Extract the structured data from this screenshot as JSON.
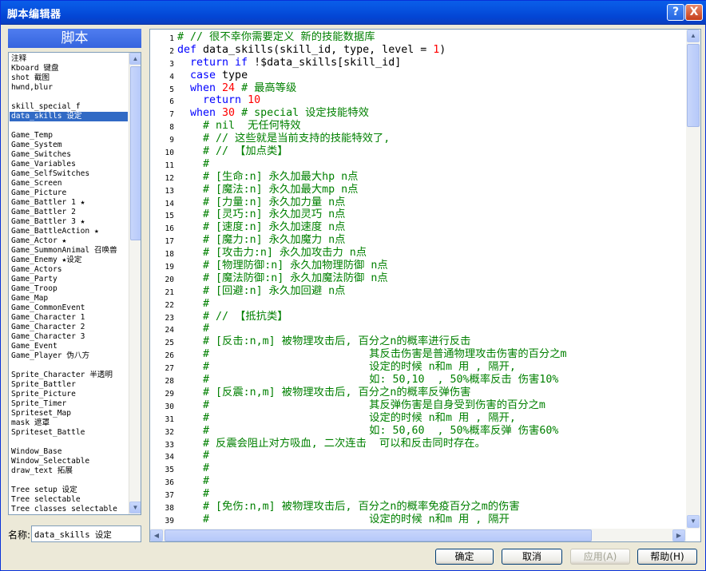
{
  "window": {
    "title": "脚本编辑器",
    "help_btn": "?",
    "close_btn": "X"
  },
  "sidebar": {
    "header": "脚本",
    "items": [
      "注释",
      "Kboard   键盘",
      "shot     截图",
      "hwnd,blur",
      "",
      "skill_special_f",
      "data_skills 设定",
      "",
      "Game_Temp",
      "Game_System",
      "Game_Switches",
      "Game_Variables",
      "Game_SelfSwitches",
      "Game_Screen",
      "Game_Picture",
      "Game_Battler 1 ★",
      "Game_Battler 2",
      "Game_Battler 3 ★",
      "Game_BattleAction ★",
      "Game_Actor ★",
      "Game_SummonAnimal 召唤兽",
      "Game_Enemy ★设定",
      "Game_Actors",
      "Game_Party",
      "Game_Troop",
      "Game_Map",
      "Game_CommonEvent",
      "Game_Character 1",
      "Game_Character 2",
      "Game_Character 3",
      "Game_Event",
      "Game_Player 伪八方",
      "",
      "Sprite_Character 半透明",
      "Sprite_Battler",
      "Sprite_Picture",
      "Sprite_Timer",
      "Spriteset_Map",
      "mask 遮罩",
      "Spriteset_Battle",
      "",
      "Window_Base",
      "Window_Selectable",
      "draw_text 拓展",
      "",
      "Tree setup 设定",
      "Tree selectable",
      "Tree classes selectable"
    ],
    "selected": "data_skills 设定"
  },
  "name_field": {
    "label": "名称:",
    "value": "data_skills 设定"
  },
  "code_lines": [
    [
      [
        "c",
        "# // 很不幸你需要定义 新的技能数据库"
      ]
    ],
    [
      [
        "k",
        "def "
      ],
      [
        "p",
        "data_skills(skill_id, type, level = "
      ],
      [
        "n",
        "1"
      ],
      [
        "p",
        ")"
      ]
    ],
    [
      [
        "p",
        "  "
      ],
      [
        "k",
        "return if "
      ],
      [
        "p",
        "!$data_skills[skill_id]"
      ]
    ],
    [
      [
        "p",
        "  "
      ],
      [
        "k",
        "case "
      ],
      [
        "p",
        "type"
      ]
    ],
    [
      [
        "p",
        "  "
      ],
      [
        "k",
        "when "
      ],
      [
        "n",
        "24 "
      ],
      [
        "c",
        "# 最高等级"
      ]
    ],
    [
      [
        "p",
        "    "
      ],
      [
        "k",
        "return "
      ],
      [
        "n",
        "10"
      ]
    ],
    [
      [
        "p",
        "  "
      ],
      [
        "k",
        "when "
      ],
      [
        "n",
        "30 "
      ],
      [
        "c",
        "# special 设定技能特效"
      ]
    ],
    [
      [
        "c",
        "    # nil  无任何特效"
      ]
    ],
    [
      [
        "c",
        "    # // 这些就是当前支持的技能特效了,"
      ]
    ],
    [
      [
        "c",
        "    # // 【加点类】"
      ]
    ],
    [
      [
        "c",
        "    #"
      ]
    ],
    [
      [
        "c",
        "    # [生命:n] 永久加最大hp n点"
      ]
    ],
    [
      [
        "c",
        "    # [魔法:n] 永久加最大mp n点"
      ]
    ],
    [
      [
        "c",
        "    # [力量:n] 永久加力量 n点"
      ]
    ],
    [
      [
        "c",
        "    # [灵巧:n] 永久加灵巧 n点"
      ]
    ],
    [
      [
        "c",
        "    # [速度:n] 永久加速度 n点"
      ]
    ],
    [
      [
        "c",
        "    # [魔力:n] 永久加魔力 n点"
      ]
    ],
    [
      [
        "c",
        "    # [攻击力:n] 永久加攻击力 n点"
      ]
    ],
    [
      [
        "c",
        "    # [物理防御:n] 永久加物理防御 n点"
      ]
    ],
    [
      [
        "c",
        "    # [魔法防御:n] 永久加魔法防御 n点"
      ]
    ],
    [
      [
        "c",
        "    # [回避:n] 永久加回避 n点"
      ]
    ],
    [
      [
        "c",
        "    #"
      ]
    ],
    [
      [
        "c",
        "    # // 【抵抗类】"
      ]
    ],
    [
      [
        "c",
        "    #"
      ]
    ],
    [
      [
        "c",
        "    # [反击:n,m] 被物理攻击后, 百分之n的概率进行反击"
      ]
    ],
    [
      [
        "c",
        "    #                         其反击伤害是普通物理攻击伤害的百分之m"
      ]
    ],
    [
      [
        "c",
        "    #                         设定的时候 n和m 用 , 隔开,"
      ]
    ],
    [
      [
        "c",
        "    #                         如: 50,10  , 50%概率反击 伤害10%"
      ]
    ],
    [
      [
        "c",
        "    # [反震:n,m] 被物理攻击后, 百分之n的概率反弹伤害"
      ]
    ],
    [
      [
        "c",
        "    #                         其反弹伤害是自身受到伤害的百分之m"
      ]
    ],
    [
      [
        "c",
        "    #                         设定的时候 n和m 用 , 隔开,"
      ]
    ],
    [
      [
        "c",
        "    #                         如: 50,60  , 50%概率反弹 伤害60%"
      ]
    ],
    [
      [
        "c",
        "    # 反震会阻止对方吸血, 二次连击  可以和反击同时存在。"
      ]
    ],
    [
      [
        "c",
        "    #"
      ]
    ],
    [
      [
        "c",
        "    #"
      ]
    ],
    [
      [
        "c",
        "    #"
      ]
    ],
    [
      [
        "c",
        "    #"
      ]
    ],
    [
      [
        "c",
        "    # [免伤:n,m] 被物理攻击后, 百分之n的概率免疫百分之m的伤害"
      ]
    ],
    [
      [
        "c",
        "    #                         设定的时候 n和m 用 , 隔开"
      ]
    ]
  ],
  "buttons": {
    "ok": "确定",
    "cancel": "取消",
    "apply": "应用(A)",
    "help": "帮助(H)"
  }
}
